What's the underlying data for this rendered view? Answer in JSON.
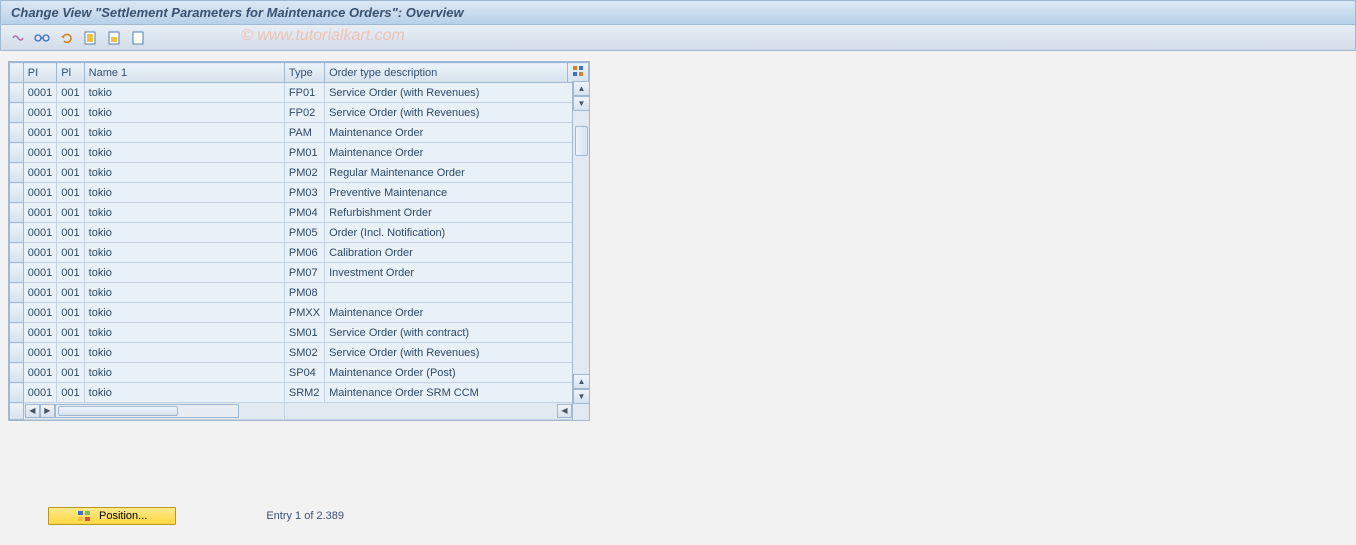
{
  "title": "Change View \"Settlement Parameters for Maintenance Orders\": Overview",
  "watermark": "© www.tutorialkart.com",
  "columns": {
    "pi": "PI",
    "pl": "Pl",
    "name": "Name 1",
    "type": "Type",
    "desc": "Order type description"
  },
  "rows": [
    {
      "pi": "0001",
      "pl": "001",
      "name": "tokio",
      "type": "FP01",
      "desc": "Service Order (with Revenues)"
    },
    {
      "pi": "0001",
      "pl": "001",
      "name": "tokio",
      "type": "FP02",
      "desc": "Service Order (with Revenues)"
    },
    {
      "pi": "0001",
      "pl": "001",
      "name": "tokio",
      "type": "PAM",
      "desc": "Maintenance Order"
    },
    {
      "pi": "0001",
      "pl": "001",
      "name": "tokio",
      "type": "PM01",
      "desc": "Maintenance Order"
    },
    {
      "pi": "0001",
      "pl": "001",
      "name": "tokio",
      "type": "PM02",
      "desc": "Regular Maintenance Order"
    },
    {
      "pi": "0001",
      "pl": "001",
      "name": "tokio",
      "type": "PM03",
      "desc": "Preventive Maintenance"
    },
    {
      "pi": "0001",
      "pl": "001",
      "name": "tokio",
      "type": "PM04",
      "desc": "Refurbishment Order"
    },
    {
      "pi": "0001",
      "pl": "001",
      "name": "tokio",
      "type": "PM05",
      "desc": "Order (Incl. Notification)"
    },
    {
      "pi": "0001",
      "pl": "001",
      "name": "tokio",
      "type": "PM06",
      "desc": "Calibration Order"
    },
    {
      "pi": "0001",
      "pl": "001",
      "name": "tokio",
      "type": "PM07",
      "desc": "Investment Order"
    },
    {
      "pi": "0001",
      "pl": "001",
      "name": "tokio",
      "type": "PM08",
      "desc": ""
    },
    {
      "pi": "0001",
      "pl": "001",
      "name": "tokio",
      "type": "PMXX",
      "desc": "Maintenance Order"
    },
    {
      "pi": "0001",
      "pl": "001",
      "name": "tokio",
      "type": "SM01",
      "desc": "Service Order (with contract)"
    },
    {
      "pi": "0001",
      "pl": "001",
      "name": "tokio",
      "type": "SM02",
      "desc": "Service Order (with Revenues)"
    },
    {
      "pi": "0001",
      "pl": "001",
      "name": "tokio",
      "type": "SP04",
      "desc": "Maintenance Order (Post)"
    },
    {
      "pi": "0001",
      "pl": "001",
      "name": "tokio",
      "type": "SRM2",
      "desc": "Maintenance Order SRM CCM"
    }
  ],
  "footer": {
    "position_label": "Position...",
    "entry_text": "Entry 1 of 2.389"
  }
}
